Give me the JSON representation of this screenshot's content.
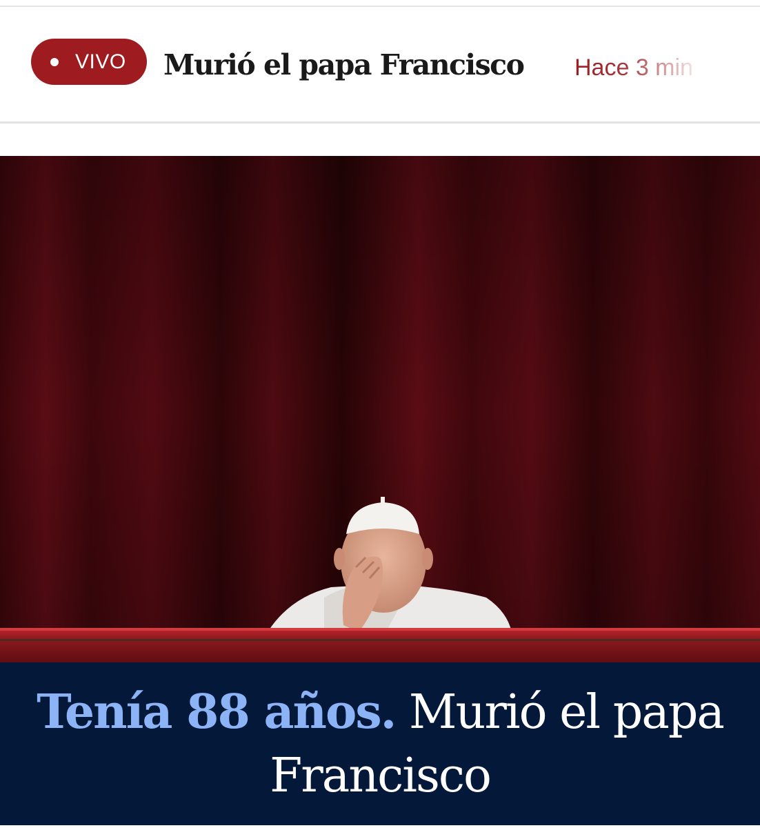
{
  "live_bar": {
    "badge_label": "VIVO",
    "headline": "Murió el papa Francisco",
    "time": "Hace 3 min"
  },
  "hero": {
    "caption_kicker": "Tenía 88 años.",
    "caption_headline": "Murió el papa Francisco"
  },
  "colors": {
    "live_red": "#9e1b20",
    "caption_bg": "#04183a",
    "kicker_blue": "#8cb3f5",
    "curtain_red": "#4a0a10"
  }
}
